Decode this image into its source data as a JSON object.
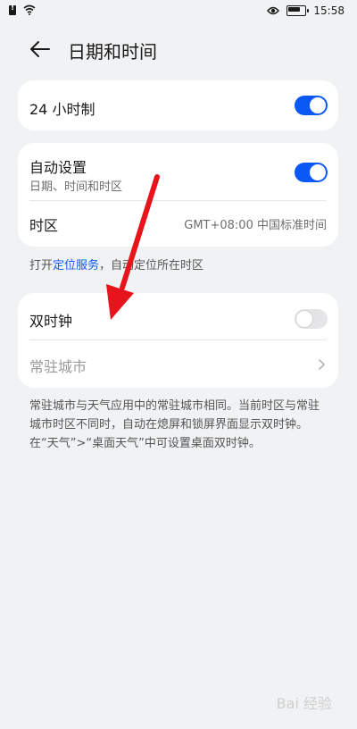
{
  "status_bar": {
    "time": "15:58"
  },
  "header": {
    "title": "日期和时间"
  },
  "card1": {
    "hour24": {
      "label": "24 小时制",
      "enabled": true
    }
  },
  "card2": {
    "auto": {
      "label": "自动设置",
      "sub": "日期、时间和时区",
      "enabled": true
    },
    "timezone": {
      "label": "时区",
      "value": "GMT+08:00 中国标准时间"
    }
  },
  "hint": {
    "prefix": "打开",
    "link": "定位服务",
    "suffix": "，自动定位所在时区"
  },
  "card3": {
    "dual": {
      "label": "双时钟",
      "enabled": false
    },
    "city": {
      "label": "常驻城市"
    }
  },
  "description": "常驻城市与天气应用中的常驻城市相同。当前时区与常驻城市时区不同时，自动在熄屏和锁屏界面显示双时钟。在“天气”>“桌面天气”中可设置桌面双时钟。",
  "watermark": "Bai 经验",
  "colors": {
    "accent": "#0a59f7",
    "annotation_arrow": "#e8141b"
  }
}
